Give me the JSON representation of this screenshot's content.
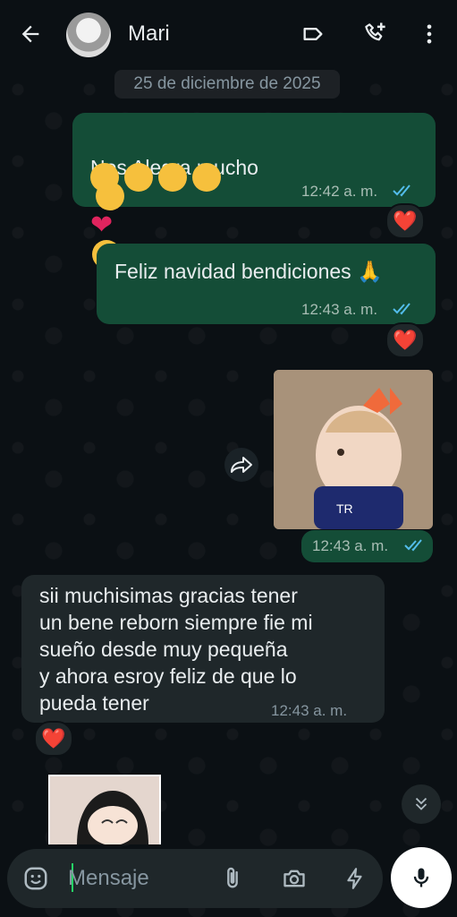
{
  "header": {
    "contact_name": "Mari"
  },
  "date_chip": "25 de diciembre de 2025",
  "messages": [
    {
      "text": "Nos Alegra mucho",
      "time": "12:42 a. m.",
      "reaction": "❤️"
    },
    {
      "text": "Feliz navidad bendiciones 🙏",
      "time": "12:43 a. m.",
      "reaction": "❤️"
    },
    {
      "time": "12:43 a. m."
    },
    {
      "text": "sii muchisimas gracias tener\nun bene reborn siempre fie mi\nsueño desde muy pequeña\ny ahora esroy feliz de que lo\npueda tener",
      "time": "12:43 a. m.",
      "reaction": "❤️"
    }
  ],
  "composer": {
    "placeholder": "Mensaje"
  },
  "colors": {
    "outgoing": "#144d37",
    "incoming": "#1f272a",
    "accent": "#25d366",
    "ticks": "#53bdeb"
  },
  "icons": [
    "back-arrow-icon",
    "label-icon",
    "add-call-icon",
    "more-vert-icon",
    "forward-icon",
    "double-check-icon",
    "emoji-icon",
    "attach-icon",
    "camera-icon",
    "bolt-icon",
    "mic-icon",
    "chevron-double-down-icon"
  ]
}
